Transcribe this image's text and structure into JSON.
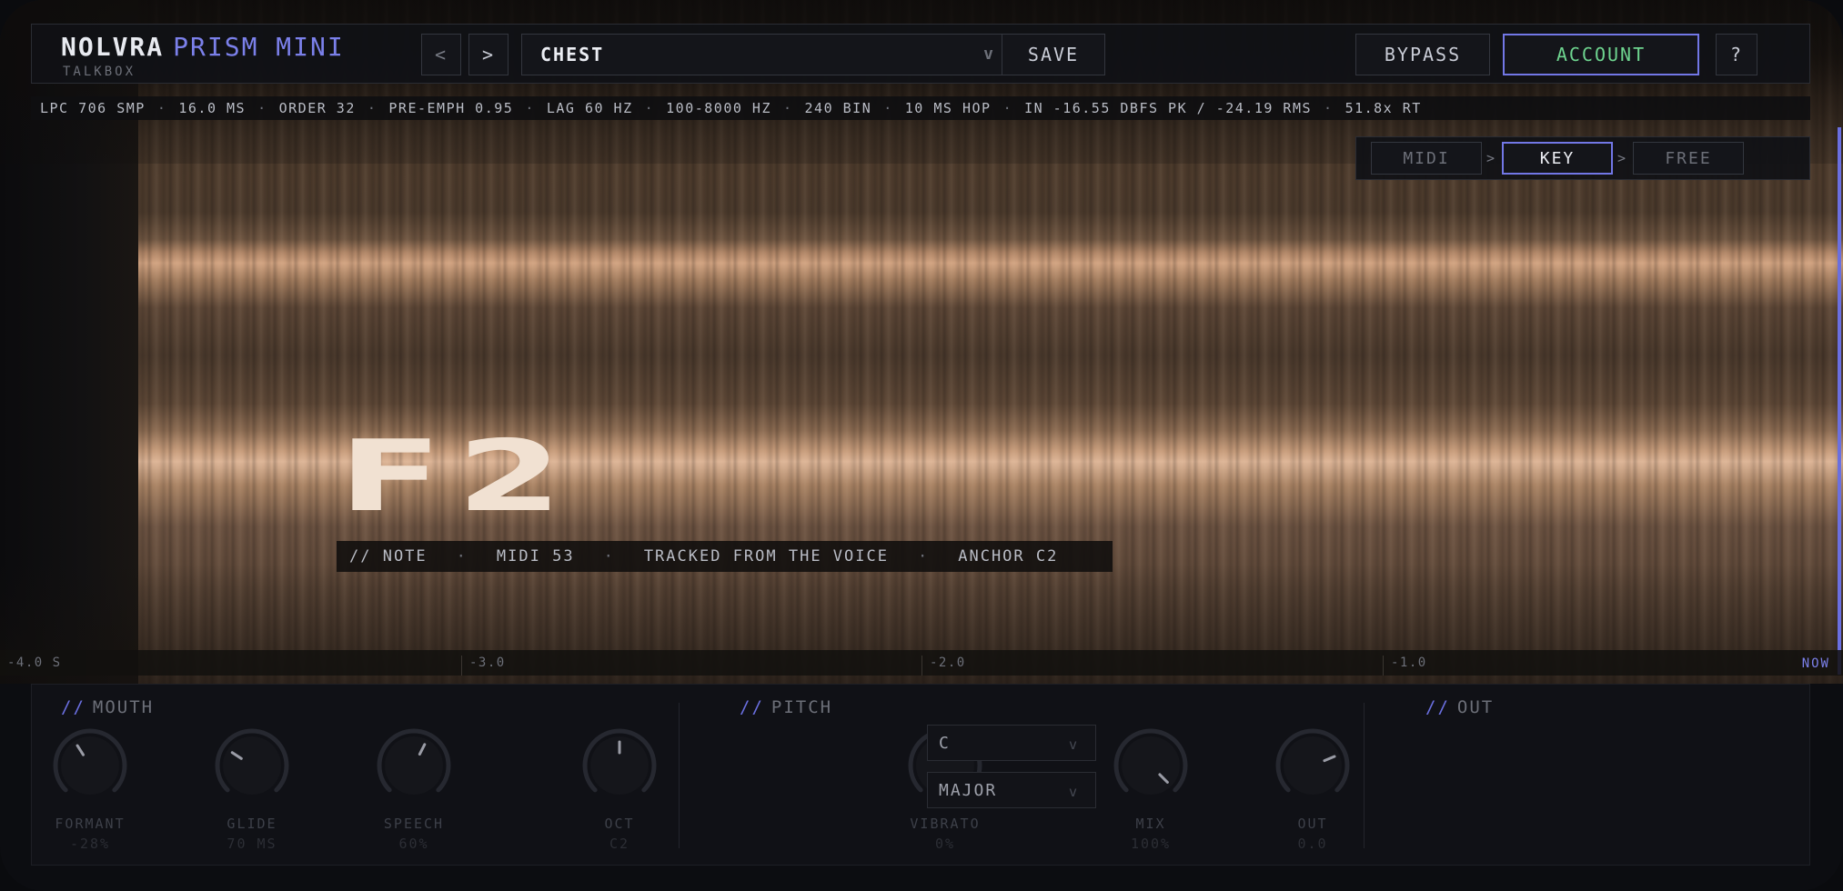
{
  "header": {
    "brand_name": "NOLVRA",
    "brand_product": "PRISM MINI",
    "brand_sub": "TALKBOX",
    "prev_label": "<",
    "next_label": ">",
    "preset": "CHEST",
    "preset_chevron": "v",
    "save_label": "SAVE",
    "bypass_label": "BYPASS",
    "account_label": "ACCOUNT",
    "help_label": "?"
  },
  "stats": [
    "LPC 706 SMP",
    "16.0 MS",
    "ORDER 32",
    "PRE-EMPH 0.95",
    "LAG 60 HZ",
    "100-8000 HZ",
    "240 BIN",
    "10 MS HOP",
    "IN -16.55 DBFS PK / -24.19 RMS",
    "51.8x RT"
  ],
  "stats_separator": "·",
  "mode": {
    "options": [
      "MIDI",
      "KEY",
      "FREE"
    ],
    "selected": "KEY",
    "arrow": ">"
  },
  "note": {
    "name": "F2",
    "info_label": "// NOTE",
    "midi": "MIDI 53",
    "source": "TRACKED FROM THE VOICE",
    "anchor": "ANCHOR C2"
  },
  "ruler": {
    "ticks": [
      "-4.0 S",
      "-3.0",
      "-2.0",
      "-1.0"
    ],
    "now": "NOW"
  },
  "sections": {
    "mouth": "MOUTH",
    "pitch": "PITCH",
    "out": "OUT",
    "slash": "//"
  },
  "knobs": [
    {
      "label": "FORMANT",
      "value": "-28%",
      "level": 0.38
    },
    {
      "label": "GLIDE",
      "value": "70 MS",
      "level": 0.29
    },
    {
      "label": "SPEECH",
      "value": "60%",
      "level": 0.6
    },
    {
      "label": "OCT",
      "value": "C2",
      "level": 0.5
    },
    {
      "label": "VIBRATO",
      "value": "0%",
      "level": 0.0
    },
    {
      "label": "MIX",
      "value": "100%",
      "level": 1.0
    },
    {
      "label": "OUT",
      "value": "0.0",
      "level": 0.75
    }
  ],
  "pitch_selects": {
    "key": "C",
    "scale": "MAJOR",
    "chevron": "v"
  },
  "colors": {
    "accent": "#7277e6",
    "account_text": "#6ed48f",
    "note_text": "#f1e1d2"
  }
}
